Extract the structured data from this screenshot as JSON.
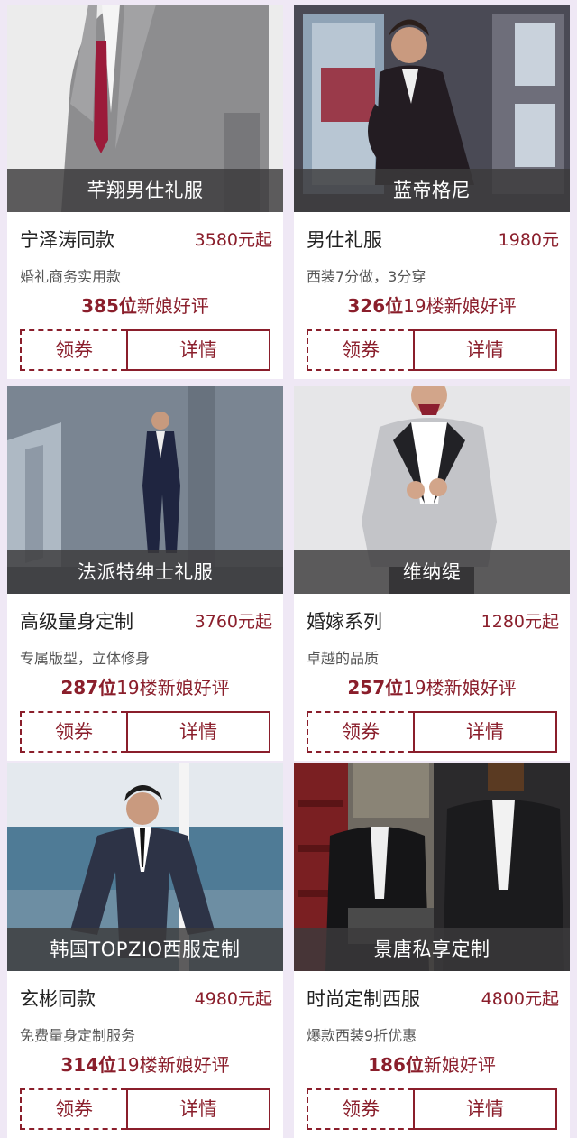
{
  "products": [
    {
      "banner": "芊翔男仕礼服",
      "name": "宁泽涛同款",
      "price": "3580元起",
      "sub": "婚礼商务实用款",
      "review_count": "385位",
      "review_text": "新娘好评",
      "coupon_label": "领券",
      "detail_label": "详情"
    },
    {
      "banner": "蓝帝格尼",
      "name": "男仕礼服",
      "price": "1980元",
      "sub": "西装7分做，3分穿",
      "review_count": "326位",
      "review_text": "19楼新娘好评",
      "coupon_label": "领券",
      "detail_label": "详情"
    },
    {
      "banner": "法派特绅士礼服",
      "name": "高级量身定制",
      "price": "3760元起",
      "sub": "专属版型，立体修身",
      "review_count": "287位",
      "review_text": "19楼新娘好评",
      "coupon_label": "领券",
      "detail_label": "详情"
    },
    {
      "banner": "维纳缇",
      "name": "婚嫁系列",
      "price": "1280元起",
      "sub": "卓越的品质",
      "review_count": "257位",
      "review_text": "19楼新娘好评",
      "coupon_label": "领券",
      "detail_label": "详情"
    },
    {
      "banner": "韩国TOPZIO西服定制",
      "name": "玄彬同款",
      "price": "4980元起",
      "sub": "免费量身定制服务",
      "review_count": "314位",
      "review_text": "19楼新娘好评",
      "coupon_label": "领券",
      "detail_label": "详情"
    },
    {
      "banner": "景唐私享定制",
      "name": "时尚定制西服",
      "price": "4800元起",
      "sub": "爆款西装9折优惠",
      "review_count": "186位",
      "review_text": "新娘好评",
      "coupon_label": "领券",
      "detail_label": "详情"
    }
  ],
  "colors": {
    "accent": "#8a1e2b",
    "page_bg": "#efe8f5",
    "banner_bg": "#3c3a3c"
  }
}
